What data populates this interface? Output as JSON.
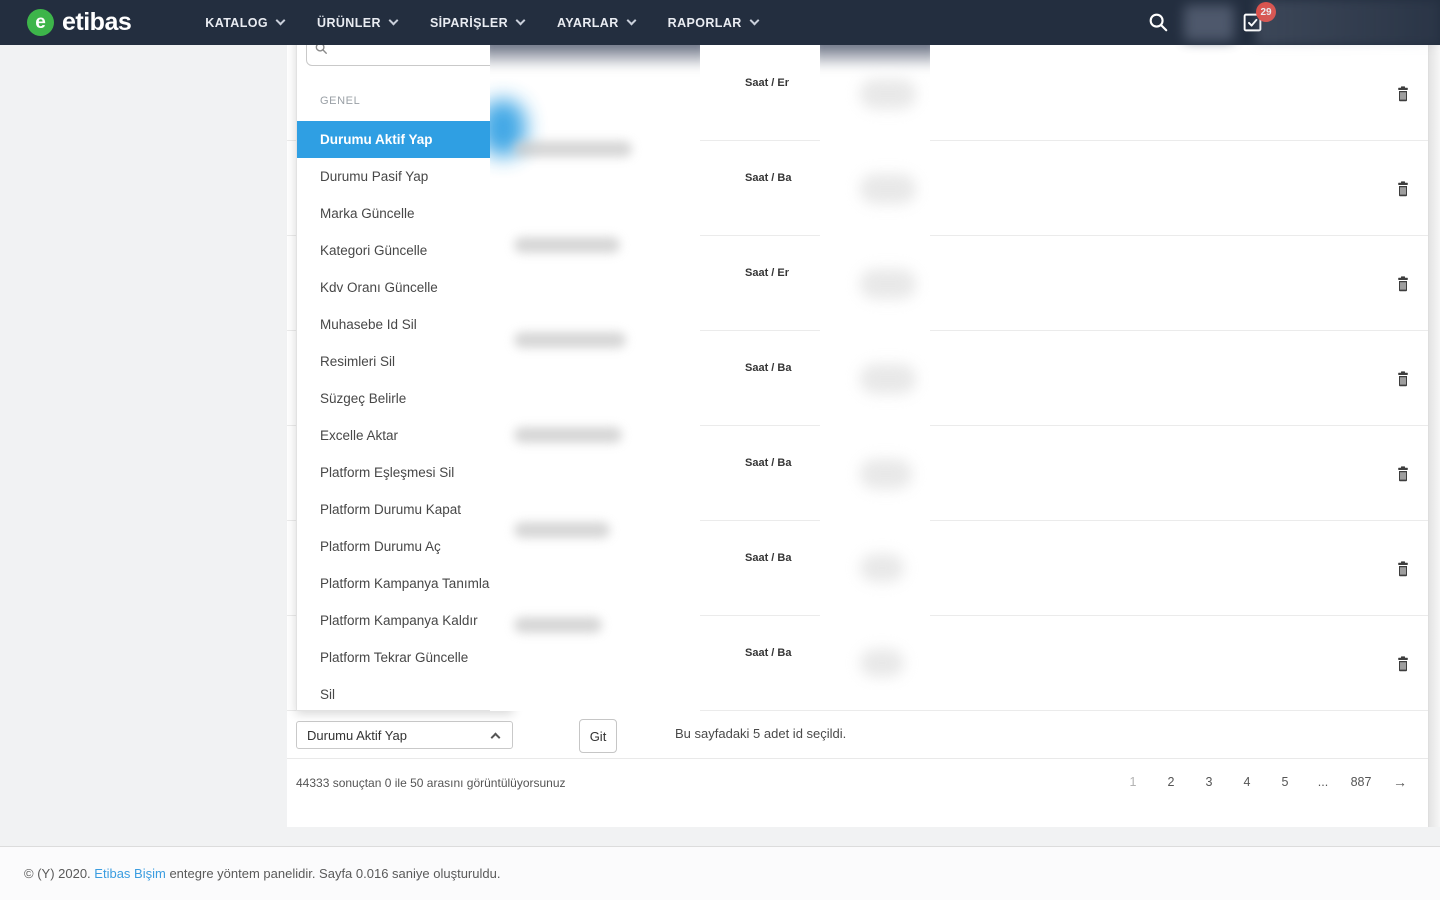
{
  "navbar": {
    "logo_mark": "e",
    "logo": "etibas",
    "menu": [
      {
        "label": "KATALOG"
      },
      {
        "label": "ÜRÜNLER"
      },
      {
        "label": "SİPARİŞLER"
      },
      {
        "label": "AYARLAR"
      },
      {
        "label": "RAPORLAR"
      }
    ],
    "notification_badge": "29"
  },
  "action_menu": {
    "search": {
      "value": "",
      "placeholder": ""
    },
    "group_label": "GENEL",
    "active_item": "Durumu Aktif Yap",
    "items": [
      "Durumu Aktif Yap",
      "Durumu Pasif Yap",
      "Marka Güncelle",
      "Kategori Güncelle",
      "Kdv Oranı Güncelle",
      "Muhasebe Id Sil",
      "Resimleri Sil",
      "Süzgeç Belirle",
      "Excelle Aktar",
      "Platform Eşleşmesi Sil",
      "Platform Durumu Kapat",
      "Platform Durumu Aç",
      "Platform Kampanya Tanımla",
      "Platform Kampanya Kaldır",
      "Platform Tekrar Güncelle",
      "Sil"
    ]
  },
  "table": {
    "rows": [
      {
        "category": "Saat / Er"
      },
      {
        "category": "Saat / Ba"
      },
      {
        "category": "Saat / Er"
      },
      {
        "category": "Saat / Ba"
      },
      {
        "category": "Saat / Ba"
      },
      {
        "category": "Saat / Ba"
      },
      {
        "category": "Saat / Ba"
      }
    ]
  },
  "toolbar": {
    "action_select_value": "Durumu Aktif Yap",
    "go_button": "Git",
    "selection_info": "Bu sayfadaki 5 adet id seçildi."
  },
  "pagination": {
    "summary": "44333 sonuçtan 0 ile 50 arasını görüntülüyorsunuz",
    "pages": [
      "1",
      "2",
      "3",
      "4",
      "5",
      "...",
      "887"
    ],
    "current_page": "1",
    "next_arrow": "→"
  },
  "footer": {
    "copyright_prefix": "© (Y) 2020.",
    "link": "Etibas Bişim",
    "copyright_suffix": "entegre yöntem panelidir. Sayfa 0.016 saniye oluşturuldu."
  },
  "colors": {
    "navbar_bg": "#232E3F",
    "accent_blue": "#2F9FE3",
    "badge_red": "#E8463C",
    "logo_green": "#3DB54A",
    "link_blue": "#3B9DE0"
  }
}
